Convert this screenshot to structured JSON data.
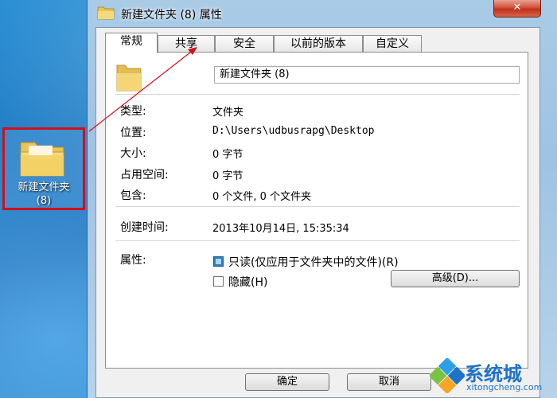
{
  "desktop": {
    "folder_label": "新建文件夹",
    "folder_sub": "(8)"
  },
  "window": {
    "title": "新建文件夹 (8) 属性",
    "close_label": "✕"
  },
  "tabs": [
    {
      "label": "常规"
    },
    {
      "label": "共享"
    },
    {
      "label": "安全"
    },
    {
      "label": "以前的版本"
    },
    {
      "label": "自定义"
    }
  ],
  "general": {
    "name_value": "新建文件夹 (8)",
    "type_label": "类型:",
    "type_value": "文件夹",
    "location_label": "位置:",
    "location_value": "D:\\Users\\udbusrapg\\Desktop",
    "size_label": "大小:",
    "size_value": "0 字节",
    "disk_label": "占用空间:",
    "disk_value": "0 字节",
    "contains_label": "包含:",
    "contains_value": "0 个文件, 0 个文件夹",
    "created_label": "创建时间:",
    "created_value": "2013年10月14日, 15:35:34",
    "attr_label": "属性:",
    "readonly_label": "只读(仅应用于文件夹中的文件)(R)",
    "readonly_state": "partial",
    "hidden_label": "隐藏(H)",
    "hidden_checked": false,
    "advanced_label": "高级(D)..."
  },
  "buttons": {
    "ok": "确定",
    "cancel": "取消"
  },
  "watermark": {
    "text": "系统城",
    "sub": "xitongcheng.com"
  },
  "colors": {
    "highlight_border": "#d0101a",
    "accent": "#1e72c8"
  }
}
